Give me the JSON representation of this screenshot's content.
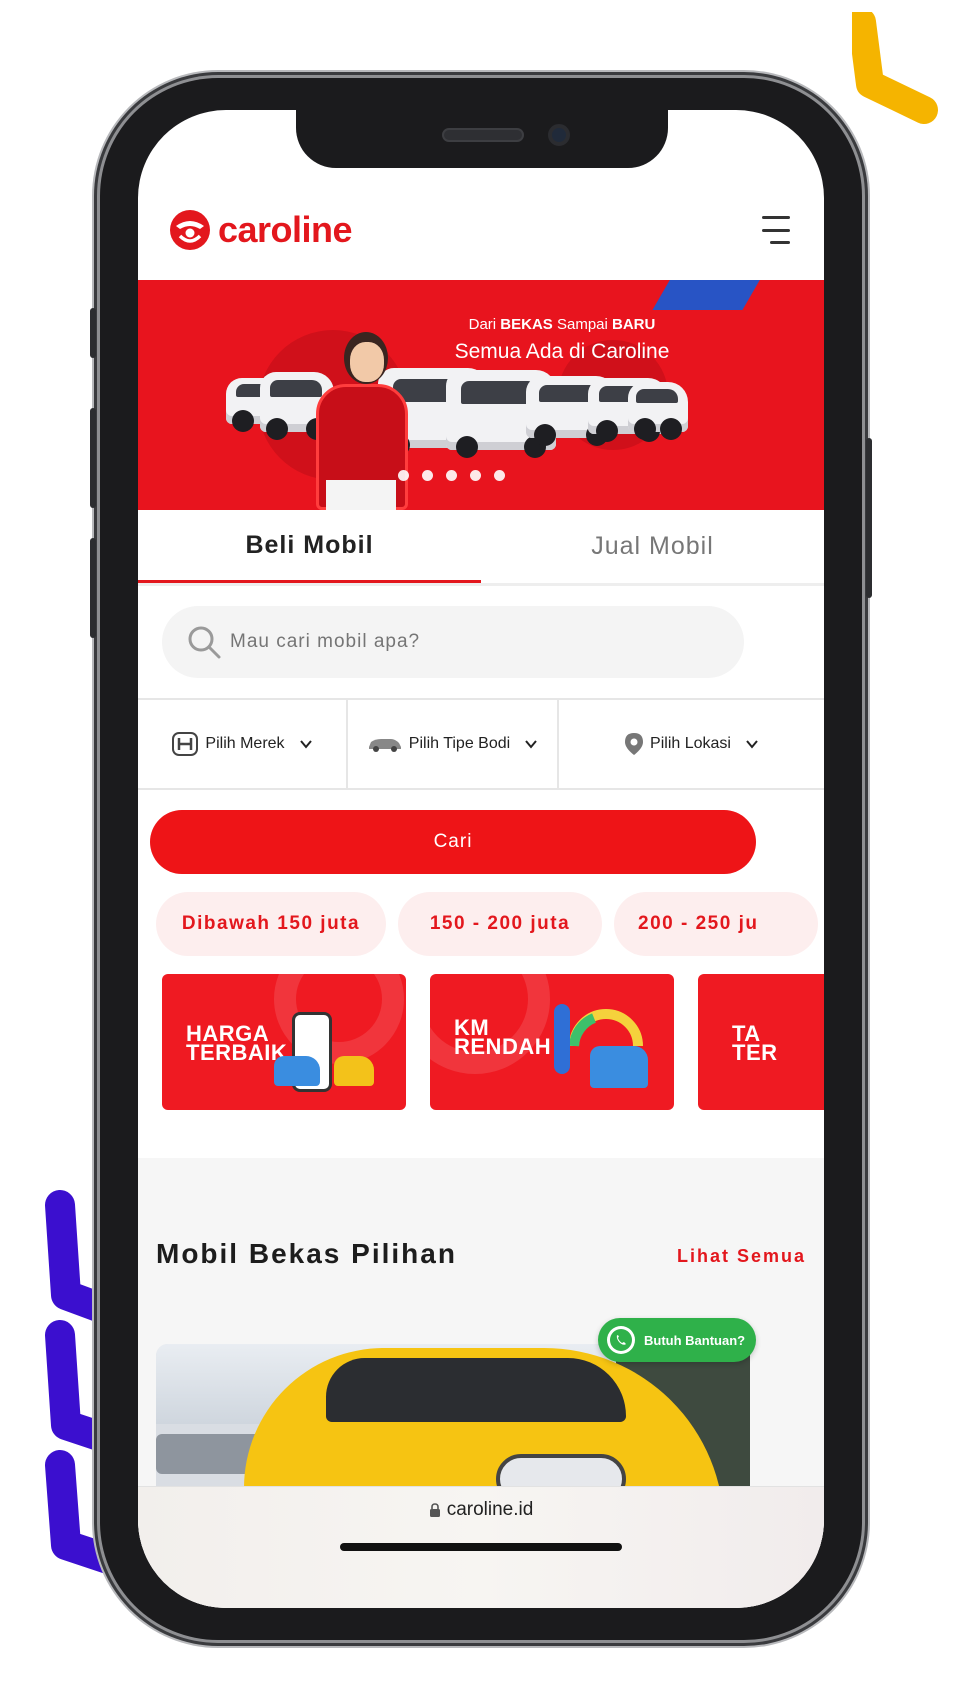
{
  "brand": {
    "name": "caroline",
    "color": "#e3171d"
  },
  "banner": {
    "line1_prefix": "Dari ",
    "line1_bold_a": "BEKAS",
    "line1_mid": " Sampai ",
    "line1_bold_b": "BARU",
    "line2": "Semua Ada di Caroline",
    "slide_count": 5
  },
  "tabs": [
    {
      "label": "Beli Mobil",
      "active": true
    },
    {
      "label": "Jual Mobil",
      "active": false
    }
  ],
  "search": {
    "placeholder": "Mau cari mobil apa?"
  },
  "filters": [
    {
      "label": "Pilih Merek",
      "icon": "brand-logo-icon"
    },
    {
      "label": "Pilih Tipe Bodi",
      "icon": "car-body-icon"
    },
    {
      "label": "Pilih Lokasi",
      "icon": "location-pin-icon"
    }
  ],
  "search_button": {
    "label": "Cari"
  },
  "price_chips": [
    "Dibawah 150 juta",
    "150 - 200 juta",
    "200 - 250 ju"
  ],
  "promos": [
    {
      "title": "HARGA\nTERBAIK"
    },
    {
      "title": "KM\nRENDAH"
    },
    {
      "title": "TA\nTER"
    }
  ],
  "section": {
    "title": "Mobil Bekas Pilihan",
    "see_all": "Lihat Semua"
  },
  "help_button": {
    "label": "Butuh Bantuan?"
  },
  "browser": {
    "url": "caroline.id"
  },
  "colors": {
    "accent": "#e3171d",
    "whatsapp": "#2fb14a",
    "deco_yellow": "#f5b400",
    "deco_blue": "#3b0fcf"
  }
}
